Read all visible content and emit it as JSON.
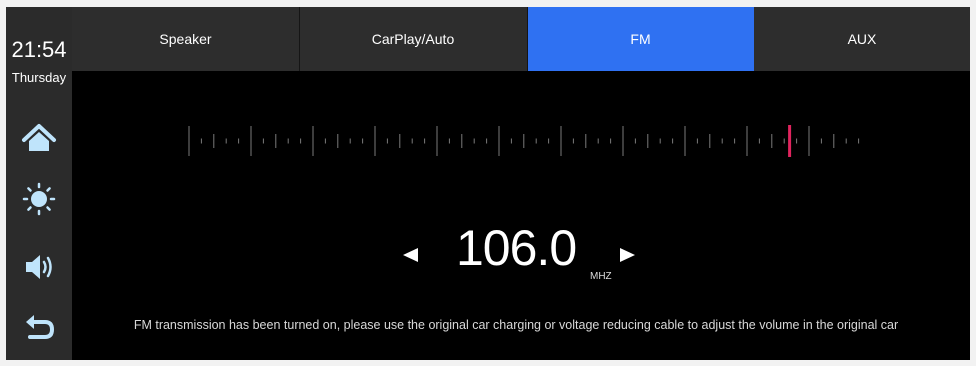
{
  "status": {
    "time": "21:54",
    "day": "Thursday"
  },
  "sidebar": {
    "items": [
      {
        "icon": "home-icon"
      },
      {
        "icon": "brightness-icon"
      },
      {
        "icon": "volume-icon"
      },
      {
        "icon": "back-icon"
      }
    ]
  },
  "tabs": [
    {
      "label": "Speaker",
      "active": false
    },
    {
      "label": "CarPlay/Auto",
      "active": false
    },
    {
      "label": "FM",
      "active": true
    },
    {
      "label": "AUX",
      "active": false
    }
  ],
  "tuner": {
    "frequency": "106.0",
    "unit": "MHZ",
    "tick_count": 55,
    "marker_tick_index": 49,
    "prev_icon": "triangle-left-icon",
    "next_icon": "triangle-right-icon"
  },
  "notice": "FM transmission has been turned on, please use the original car charging or voltage reducing cable to adjust the volume in the original car",
  "colors": {
    "accent": "#2f71f2",
    "marker": "#e0245e",
    "tab_bg": "#2d2d2d",
    "sidebar_bg": "#2b2b2b",
    "icon": "#bfe4fb"
  }
}
